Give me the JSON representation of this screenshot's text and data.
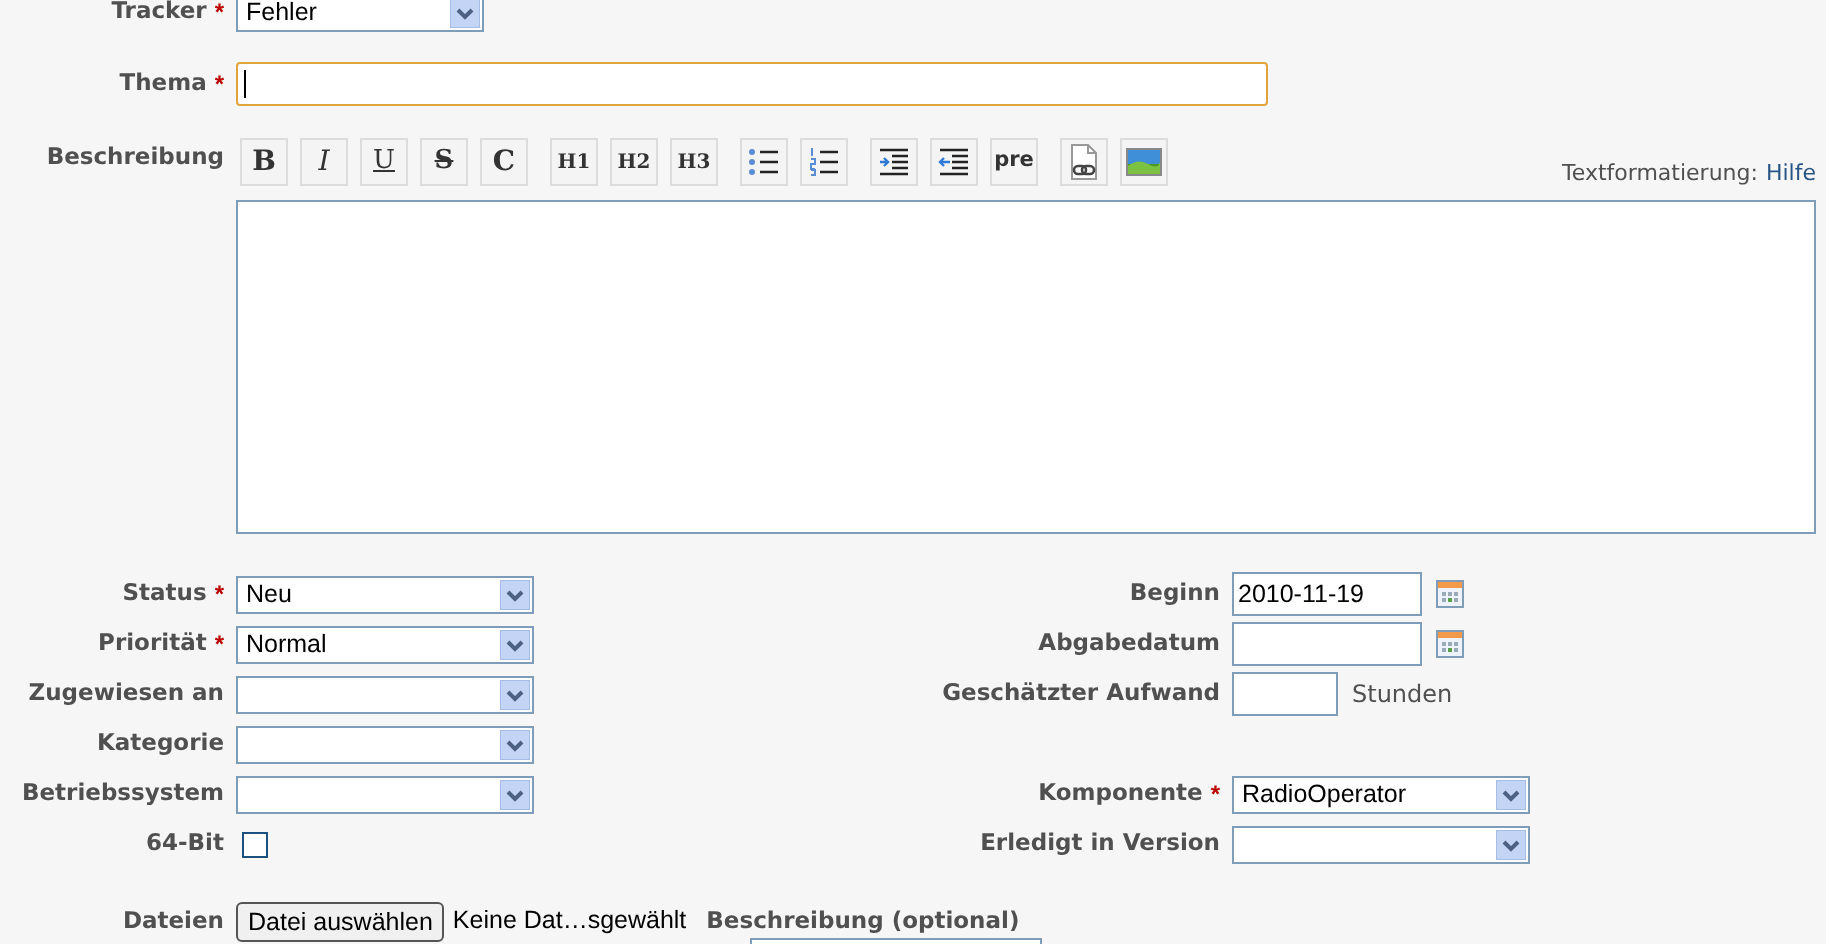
{
  "tracker": {
    "label": "Tracker",
    "marker": "*",
    "value": "Fehler"
  },
  "subject": {
    "label": "Thema",
    "marker": "*",
    "focused": true
  },
  "description": {
    "label": "Beschreibung",
    "help_prefix": "Textformatierung:",
    "help_link": "Hilfe"
  },
  "toolbar": [
    [
      {
        "kind": "bold",
        "label": "B"
      },
      {
        "kind": "italic",
        "label": "I"
      },
      {
        "kind": "underline",
        "label": "U"
      },
      {
        "kind": "strike",
        "label": "S"
      },
      {
        "kind": "code",
        "label": "C"
      }
    ],
    [
      {
        "kind": "heading",
        "label": "H1"
      },
      {
        "kind": "heading",
        "label": "H2"
      },
      {
        "kind": "heading",
        "label": "H3"
      }
    ],
    [
      {
        "kind": "ul"
      },
      {
        "kind": "ol"
      }
    ],
    [
      {
        "kind": "indent"
      },
      {
        "kind": "outdent"
      },
      {
        "kind": "pre",
        "label": "pre"
      }
    ],
    [
      {
        "kind": "link"
      },
      {
        "kind": "image"
      }
    ]
  ],
  "left_fields": [
    {
      "label": "Status",
      "marker": "*",
      "kind": "select",
      "value": "Neu"
    },
    {
      "label": "Priorität",
      "marker": "*",
      "kind": "select",
      "value": "Normal"
    },
    {
      "label": "Zugewiesen an",
      "kind": "select"
    },
    {
      "label": "Kategorie",
      "kind": "select"
    },
    {
      "label": "Betriebssystem",
      "kind": "select"
    },
    {
      "label": "64-Bit",
      "kind": "checkbox",
      "checked": false
    }
  ],
  "right_fields_upper": [
    {
      "label": "Beginn",
      "kind": "date",
      "value": "2010-11-19"
    },
    {
      "label": "Abgabedatum",
      "kind": "date"
    },
    {
      "label": "Geschätzter Aufwand",
      "kind": "hours",
      "unit": "Stunden"
    }
  ],
  "right_fields_lower": [
    {
      "label": "Komponente",
      "marker": "*",
      "kind": "select",
      "value": "RadioOperator"
    },
    {
      "label": "Erledigt in Version",
      "kind": "select"
    }
  ],
  "files": {
    "label": "Dateien",
    "button": "Datei auswählen",
    "status": "Keine Dat…sgewählt",
    "description_label": "Beschreibung (optional)"
  }
}
